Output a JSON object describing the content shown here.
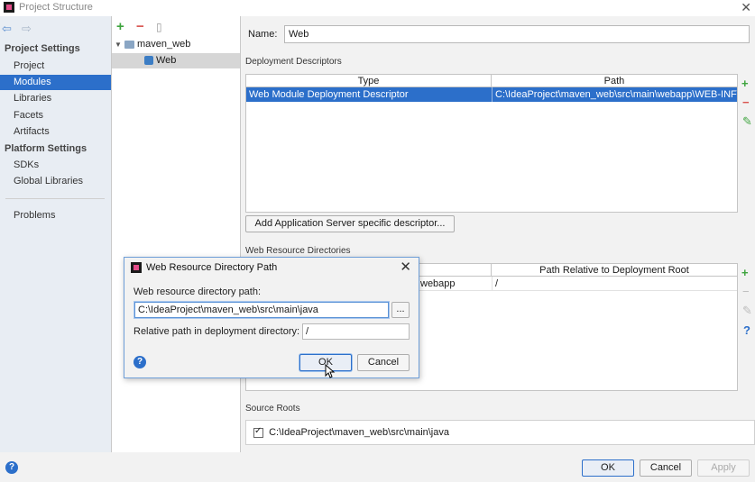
{
  "window": {
    "title": "Project Structure"
  },
  "sidebar": {
    "project_settings_heading": "Project Settings",
    "project_items": [
      "Project",
      "Modules",
      "Libraries",
      "Facets",
      "Artifacts"
    ],
    "platform_settings_heading": "Platform Settings",
    "platform_items": [
      "SDKs",
      "Global Libraries"
    ],
    "problems": "Problems",
    "selected": "Modules"
  },
  "tree": {
    "root": "maven_web",
    "child": "Web"
  },
  "main": {
    "name_label": "Name:",
    "name_value": "Web",
    "deployment_descriptors": {
      "title": "Deployment Descriptors",
      "columns": [
        "Type",
        "Path"
      ],
      "rows": [
        {
          "type": "Web Module Deployment Descriptor",
          "path": "C:\\IdeaProject\\maven_web\\src\\main\\webapp\\WEB-INF\\web"
        }
      ],
      "add_button": "Add Application Server specific descriptor..."
    },
    "web_resource_directories": {
      "title": "Web Resource Directories",
      "columns": [
        "Path Relative to Deployment Root"
      ],
      "rows": [
        {
          "dir_partial": "webapp",
          "relative": "/"
        }
      ]
    },
    "source_roots": {
      "title": "Source Roots",
      "items": [
        "C:\\IdeaProject\\maven_web\\src\\main\\java"
      ]
    }
  },
  "footer": {
    "ok": "OK",
    "cancel": "Cancel",
    "apply": "Apply"
  },
  "dialog": {
    "title": "Web Resource Directory Path",
    "path_label": "Web resource directory path:",
    "path_value": "C:\\IdeaProject\\maven_web\\src\\main\\java",
    "browse": "...",
    "relative_label": "Relative path in deployment directory:",
    "relative_value": "/",
    "ok": "OK",
    "cancel": "Cancel",
    "help": "?"
  },
  "colors": {
    "selection": "#2c6fca",
    "add_green": "#3ea43e",
    "remove_red": "#d9534f"
  }
}
